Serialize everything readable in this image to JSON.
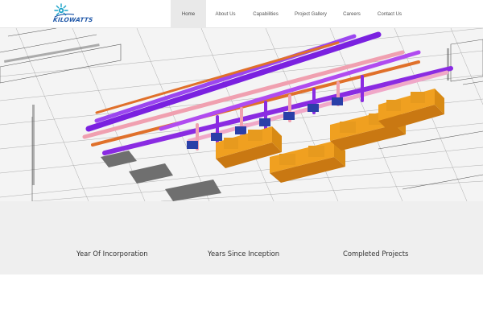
{
  "logo": {
    "text": "KILOWATTS",
    "icon": "sun-burst-logo-icon"
  },
  "nav": {
    "items": [
      {
        "label": "Home",
        "active": true
      },
      {
        "label": "About Us",
        "active": false
      },
      {
        "label": "Capabilities",
        "active": false
      },
      {
        "label": "Project Gallery",
        "active": false
      },
      {
        "label": "Careers",
        "active": false
      },
      {
        "label": "Contact Us",
        "active": false
      }
    ]
  },
  "hero": {
    "image": "hvac-piping-blueprint-render"
  },
  "stats": {
    "items": [
      {
        "label": "Year Of Incorporation"
      },
      {
        "label": "Years Since Inception"
      },
      {
        "label": "Completed Projects"
      }
    ]
  },
  "colors": {
    "brand_blue": "#1f57a8",
    "logo_teal": "#1aa3c9",
    "pipe_purple": "#8a2be2",
    "pipe_orange": "#e07a2e",
    "chiller_orange": "#e79a1e"
  }
}
